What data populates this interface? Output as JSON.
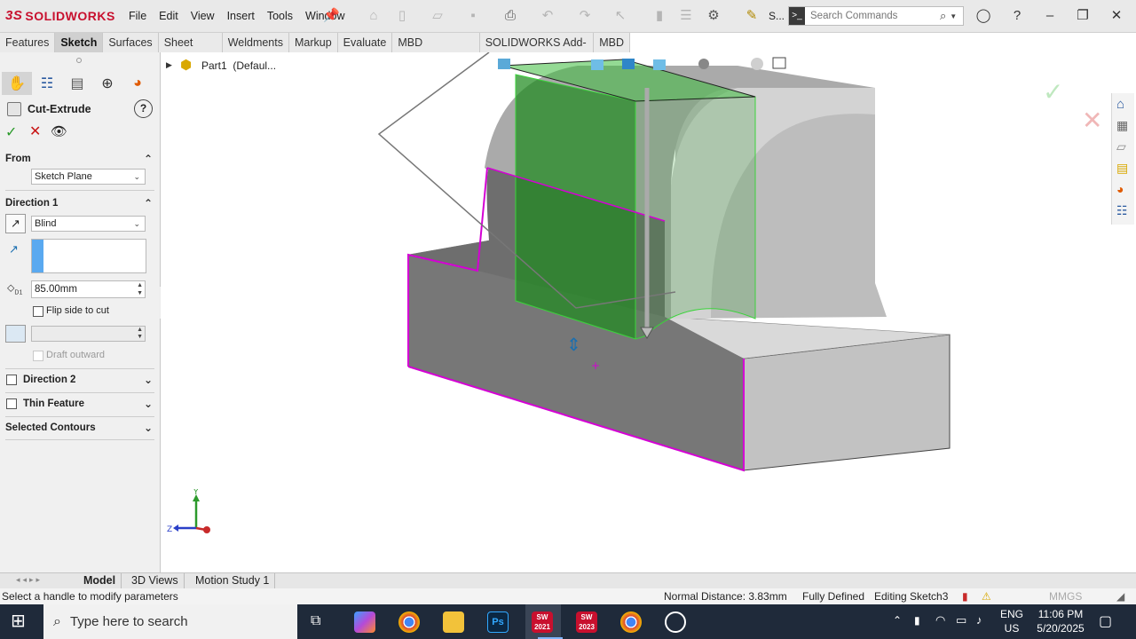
{
  "app": {
    "logo_text": "SOLIDWORKS",
    "logo_mark": "3S"
  },
  "menu": [
    "File",
    "Edit",
    "View",
    "Insert",
    "Tools",
    "Window"
  ],
  "toolbar": {
    "s_label": "S...",
    "search_placeholder": "Search Commands"
  },
  "command_tabs": [
    "Features",
    "Sketch",
    "Surfaces",
    "Sheet Metal",
    "Weldments",
    "Markup",
    "Evaluate",
    "MBD Dimensions",
    "SOLIDWORKS Add-Ins",
    "MBD"
  ],
  "active_command_tab": "Sketch",
  "tree": {
    "part_label": "Part1",
    "config": "(Defaul..."
  },
  "property_manager": {
    "title": "Cut-Extrude",
    "from": {
      "label": "From",
      "value": "Sketch Plane"
    },
    "direction1": {
      "label": "Direction 1",
      "end_condition": "Blind",
      "depth": "85.00mm",
      "flip_label": "Flip side to cut",
      "draft_label": "Draft outward"
    },
    "direction2": {
      "label": "Direction 2"
    },
    "thin_feature": {
      "label": "Thin Feature"
    },
    "selected_contours": {
      "label": "Selected Contours"
    }
  },
  "bottom_tabs": [
    "Model",
    "3D Views",
    "Motion Study 1"
  ],
  "triad": {
    "x": "",
    "y": "Y",
    "z": "Z"
  },
  "status": {
    "hint": "Select a handle to modify parameters",
    "normal_distance": "Normal Distance: 3.83mm",
    "defined": "Fully Defined",
    "editing": "Editing Sketch3",
    "units": "MMGS"
  },
  "taskbar": {
    "search_placeholder": "Type here to search",
    "lang": "ENG",
    "region": "US",
    "time": "11:06 PM",
    "date": "5/20/2025",
    "sw2021": "SW 2021",
    "sw2023": "SW 2023"
  },
  "colors": {
    "accent_red": "#c8102e",
    "edge_magenta": "#d400d4",
    "preview_green": "#1f8a1f",
    "panel": "#f0f0f0"
  }
}
